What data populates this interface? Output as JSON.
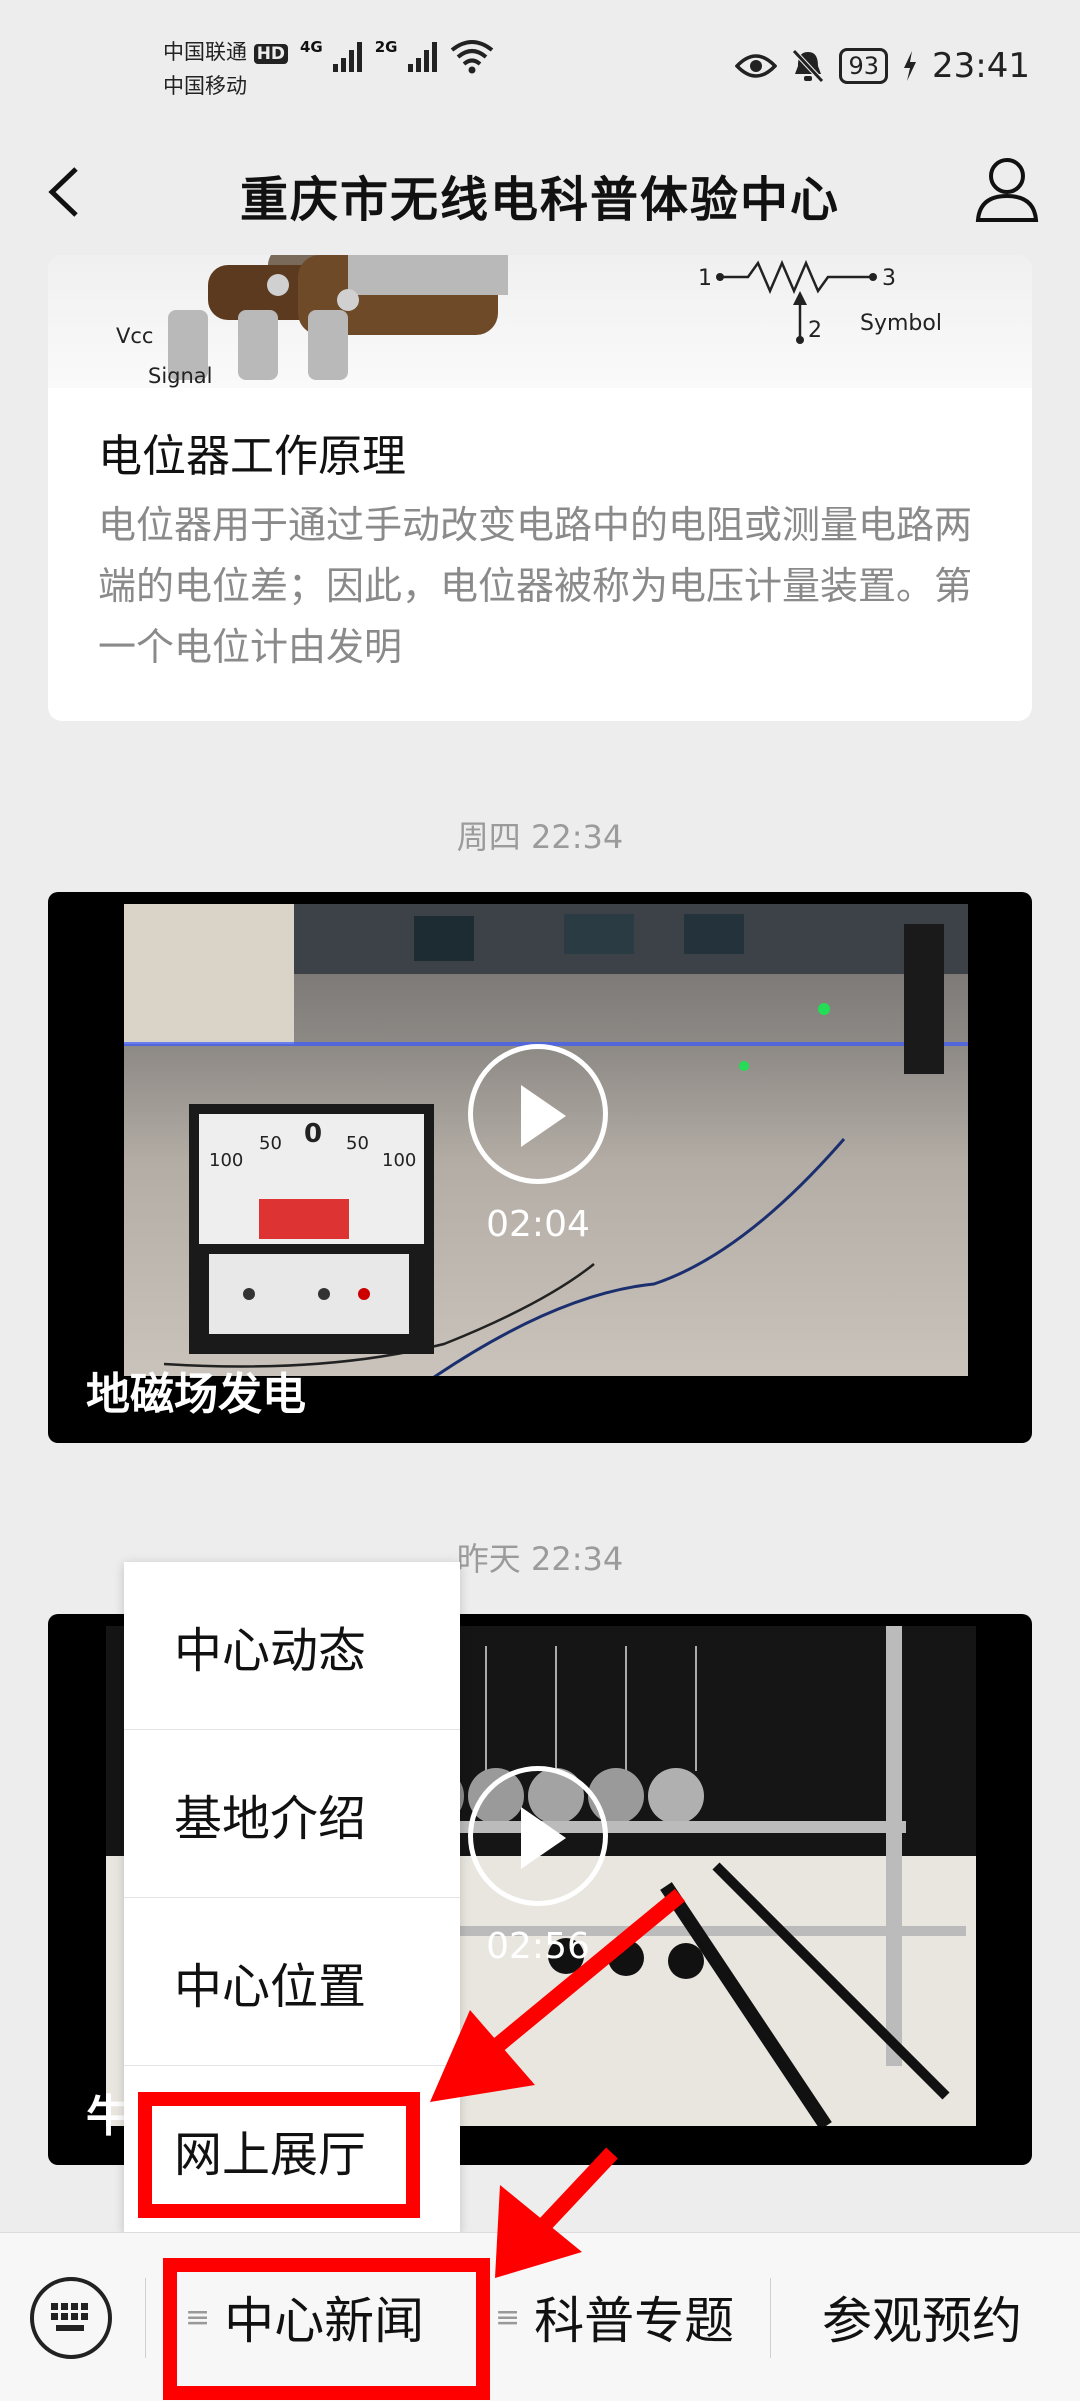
{
  "status_bar": {
    "carrier_1": "中国联通",
    "carrier_1_badge": "HD",
    "carrier_2": "中国移动",
    "net_1": "4G",
    "net_2": "2G",
    "battery": "93",
    "time": "23:41"
  },
  "header": {
    "title": "重庆市无线电科普体验中心"
  },
  "article": {
    "image_labels": {
      "vcc": "Vcc",
      "signal": "Signal",
      "symbol": "Symbol",
      "n1": "1",
      "n2": "2",
      "n3": "3"
    },
    "title": "电位器工作原理",
    "description": "电位器用于通过手动改变电路中的电阻或测量电路两端的电位差；因此，电位器被称为电压计量装置。第一个电位计由发明"
  },
  "messages": [
    {
      "timestamp": "周四 22:34",
      "duration": "02:04",
      "title": "地磁场发电"
    },
    {
      "timestamp": "昨天 22:34",
      "duration": "02:56",
      "title": "牛"
    }
  ],
  "meter_labels": [
    "100",
    "50",
    "0",
    "50",
    "100"
  ],
  "popup_menu": [
    "中心动态",
    "基地介绍",
    "中心位置",
    "网上展厅"
  ],
  "bottom_menu": {
    "tab1": "中心新闻",
    "tab2": "科普专题",
    "tab3": "参观预约"
  },
  "colors": {
    "accent_red": "#ff0000",
    "background": "#ededed"
  }
}
